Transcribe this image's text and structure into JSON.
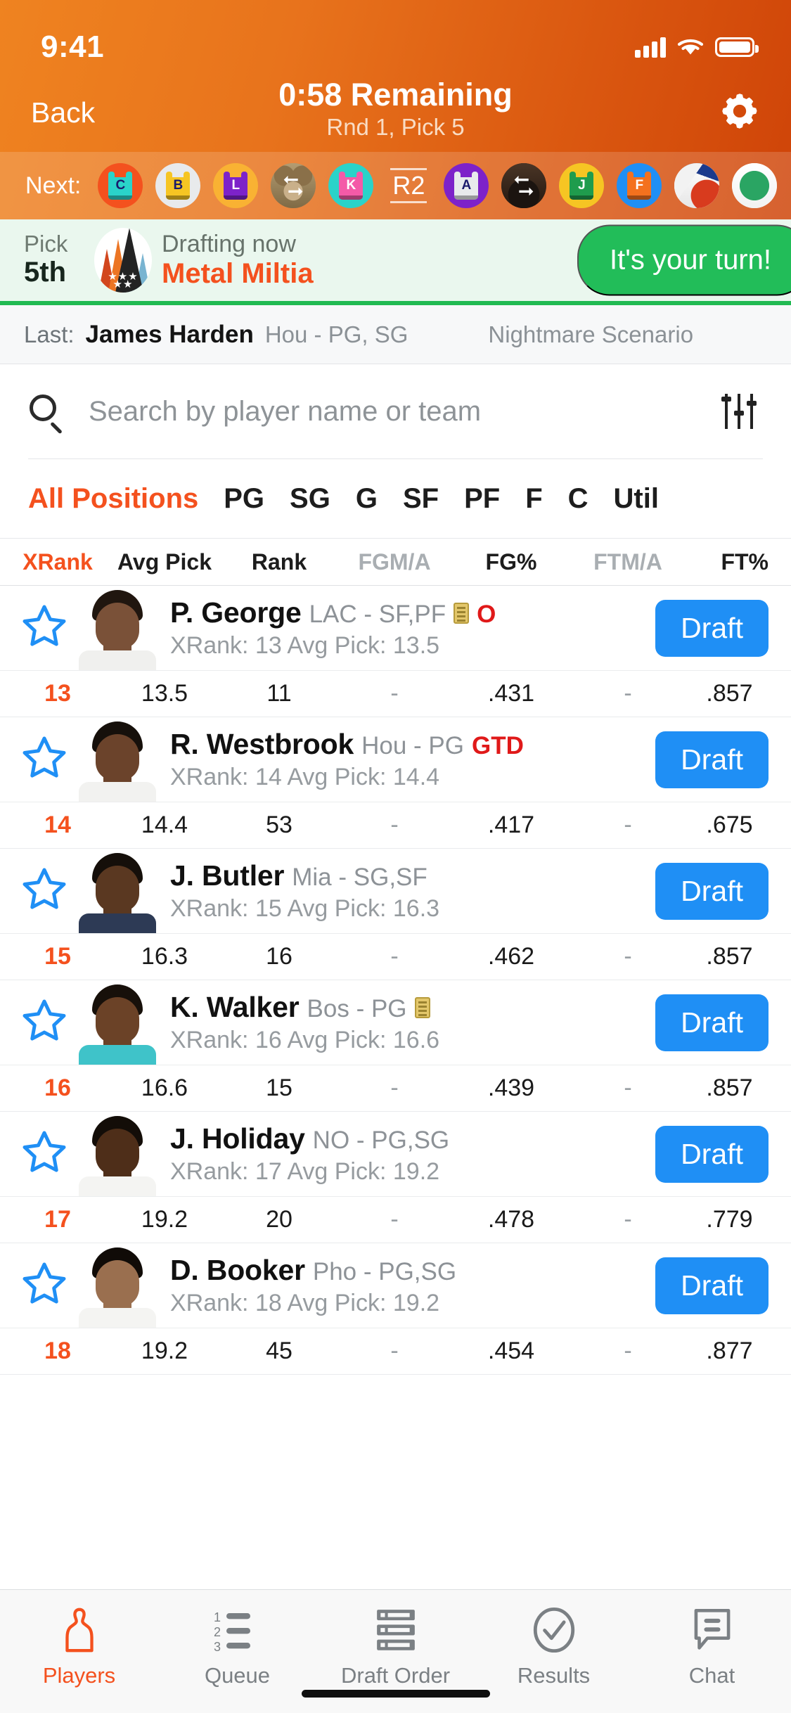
{
  "status_bar": {
    "time": "9:41",
    "signal_icon": "cellular-signal-icon",
    "wifi_icon": "wifi-icon",
    "battery_icon": "battery-icon"
  },
  "nav": {
    "back_label": "Back",
    "title": "0:58 Remaining",
    "subtitle": "Rnd 1, Pick 5",
    "settings_icon": "gear-icon"
  },
  "next_strip": {
    "label": "Next:",
    "avatars": [
      {
        "kind": "jersey",
        "letter": "C",
        "bg": "#f4511e",
        "shirt": "#2ad3c9",
        "name": "team-avatar-c"
      },
      {
        "kind": "jersey",
        "letter": "B",
        "bg": "#e8eaec",
        "shirt": "#f6c523",
        "name": "team-avatar-b"
      },
      {
        "kind": "jersey",
        "letter": "L",
        "bg": "#f9b233",
        "shirt": "#7d22c9",
        "name": "team-avatar-l"
      },
      {
        "kind": "photo-dog",
        "letter": "",
        "bg": "#9b8a63",
        "shirt": "",
        "name": "team-avatar-dog-autopick"
      },
      {
        "kind": "jersey",
        "letter": "K",
        "bg": "#2ad3c9",
        "shirt": "#f45aa8",
        "name": "team-avatar-k"
      },
      {
        "kind": "round-marker",
        "letter": "R2",
        "bg": "",
        "shirt": "",
        "name": "round-2-marker"
      },
      {
        "kind": "jersey",
        "letter": "A",
        "bg": "#7d22c9",
        "shirt": "#e8eaec",
        "name": "team-avatar-a"
      },
      {
        "kind": "photo-dark",
        "letter": "",
        "bg": "#3a2a1f",
        "shirt": "",
        "name": "team-avatar-dark-autopick"
      },
      {
        "kind": "jersey",
        "letter": "J",
        "bg": "#f6c523",
        "shirt": "#1f9c4d",
        "name": "team-avatar-j"
      },
      {
        "kind": "jersey",
        "letter": "F",
        "bg": "#1f8ff5",
        "shirt": "#f4711e",
        "name": "team-avatar-f"
      },
      {
        "kind": "logo",
        "letter": "",
        "bg": "#ffffff",
        "shirt": "",
        "name": "team-avatar-logo"
      },
      {
        "kind": "logo2",
        "letter": "",
        "bg": "#ffffff",
        "shirt": "",
        "name": "team-avatar-logo-green"
      }
    ]
  },
  "drafting": {
    "pick_key": "Pick",
    "pick_value": "5th",
    "team_logo_name": "metal-miltia-logo",
    "status_label": "Drafting now",
    "team_name": "Metal Miltia",
    "turn_button": "It's your turn!",
    "accent_green": "#22bd59",
    "accent_orange": "#f4511e"
  },
  "last_pick": {
    "key": "Last:",
    "player": "James Harden",
    "team_pos": "Hou - PG, SG",
    "note": "Nightmare Scenario"
  },
  "search": {
    "placeholder": "Search by player name or team",
    "value": "",
    "search_icon": "search-icon",
    "filter_icon": "sliders-filter-icon"
  },
  "position_tabs": {
    "active": "All Positions",
    "items": [
      "All Positions",
      "PG",
      "SG",
      "G",
      "SF",
      "PF",
      "F",
      "C",
      "Util"
    ]
  },
  "stats_header": {
    "columns": [
      {
        "label": "XRank",
        "style": "accent"
      },
      {
        "label": "Avg Pick",
        "style": "normal"
      },
      {
        "label": "Rank",
        "style": "normal"
      },
      {
        "label": "FGM/A",
        "style": "muted"
      },
      {
        "label": "FG%",
        "style": "normal"
      },
      {
        "label": "FTM/A",
        "style": "muted"
      },
      {
        "label": "FT%",
        "style": "normal"
      }
    ]
  },
  "players": [
    {
      "name": "P. George",
      "team_pos": "LAC - SF,PF",
      "has_note": true,
      "badge": "O",
      "badge_kind": "out",
      "sub": "XRank: 13   Avg Pick: 13.5",
      "draft_label": "Draft",
      "stats": {
        "xrank": "13",
        "avg_pick": "13.5",
        "rank": "11",
        "fgma": "-",
        "fgp": ".431",
        "ftma": "-",
        "ftp": ".857"
      },
      "colors": {
        "hair": "#20160f",
        "skin": "#7a5138",
        "jersey": "#f0f0ee"
      }
    },
    {
      "name": "R. Westbrook",
      "team_pos": "Hou - PG",
      "has_note": false,
      "badge": "GTD",
      "badge_kind": "gtd",
      "sub": "XRank: 14   Avg Pick: 14.4",
      "draft_label": "Draft",
      "stats": {
        "xrank": "14",
        "avg_pick": "14.4",
        "rank": "53",
        "fgma": "-",
        "fgp": ".417",
        "ftma": "-",
        "ftp": ".675"
      },
      "colors": {
        "hair": "#16100b",
        "skin": "#6b432b",
        "jersey": "#f2f2f0"
      }
    },
    {
      "name": "J. Butler",
      "team_pos": "Mia - SG,SF",
      "has_note": false,
      "badge": "",
      "badge_kind": "",
      "sub": "XRank: 15   Avg Pick: 16.3",
      "draft_label": "Draft",
      "stats": {
        "xrank": "15",
        "avg_pick": "16.3",
        "rank": "16",
        "fgma": "-",
        "fgp": ".462",
        "ftma": "-",
        "ftp": ".857"
      },
      "colors": {
        "hair": "#150f0a",
        "skin": "#5a3821",
        "jersey": "#2d3a55"
      }
    },
    {
      "name": "K. Walker",
      "team_pos": "Bos - PG",
      "has_note": true,
      "badge": "",
      "badge_kind": "",
      "sub": "XRank: 16   Avg Pick: 16.6",
      "draft_label": "Draft",
      "stats": {
        "xrank": "16",
        "avg_pick": "16.6",
        "rank": "15",
        "fgma": "-",
        "fgp": ".439",
        "ftma": "-",
        "ftp": ".857"
      },
      "colors": {
        "hair": "#17100a",
        "skin": "#6b4227",
        "jersey": "#3fc3c9"
      }
    },
    {
      "name": "J. Holiday",
      "team_pos": "NO - PG,SG",
      "has_note": false,
      "badge": "",
      "badge_kind": "",
      "sub": "XRank: 17   Avg Pick: 19.2",
      "draft_label": "Draft",
      "stats": {
        "xrank": "17",
        "avg_pick": "19.2",
        "rank": "20",
        "fgma": "-",
        "fgp": ".478",
        "ftma": "-",
        "ftp": ".779"
      },
      "colors": {
        "hair": "#130d08",
        "skin": "#4e2e19",
        "jersey": "#f4f4f2"
      }
    },
    {
      "name": "D. Booker",
      "team_pos": "Pho - PG,SG",
      "has_note": false,
      "badge": "",
      "badge_kind": "",
      "sub": "XRank: 18   Avg Pick: 19.2",
      "draft_label": "Draft",
      "stats": {
        "xrank": "18",
        "avg_pick": "19.2",
        "rank": "45",
        "fgma": "-",
        "fgp": ".454",
        "ftma": "-",
        "ftp": ".877"
      },
      "colors": {
        "hair": "#100b07",
        "skin": "#9a6f4f",
        "jersey": "#f4f4f2"
      }
    }
  ],
  "tab_bar": {
    "active": "Players",
    "items": [
      {
        "label": "Players",
        "icon": "player-jersey-icon"
      },
      {
        "label": "Queue",
        "icon": "numbered-list-icon"
      },
      {
        "label": "Draft Order",
        "icon": "draft-order-rows-icon"
      },
      {
        "label": "Results",
        "icon": "check-circle-icon"
      },
      {
        "label": "Chat",
        "icon": "chat-bubble-icon"
      }
    ]
  }
}
